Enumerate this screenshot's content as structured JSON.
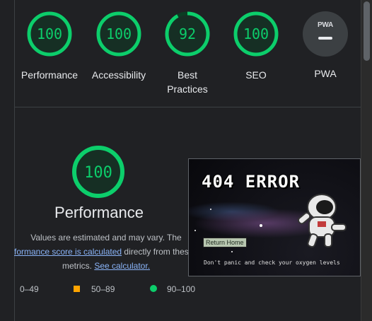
{
  "colors": {
    "pass": "#0cce6b",
    "average": "#ffa400",
    "fail": "#ff4e42",
    "link": "#8ab4f8"
  },
  "gauges": [
    {
      "label": "Performance",
      "score": 100
    },
    {
      "label": "Accessibility",
      "score": 100
    },
    {
      "label": "Best Practices",
      "label_line1": "Best",
      "label_line2": "Practices",
      "score": 92
    },
    {
      "label": "SEO",
      "score": 100
    }
  ],
  "pwa": {
    "badge": "PWA",
    "label": "PWA"
  },
  "performance": {
    "score": 100,
    "title": "Performance",
    "desc_line1": "Values are estimated and may vary. The",
    "desc_link1": "formance score is calculated",
    "desc_line2_rest": " directly from these",
    "desc_line3": "metrics. ",
    "desc_link2": "See calculator."
  },
  "legend": {
    "fail_range": "0–49",
    "average_range": "50–89",
    "pass_range": "90–100"
  },
  "screenshot": {
    "title": "404 ERROR",
    "button": "Return Home",
    "message": "Don't panic and check your oxygen levels"
  }
}
